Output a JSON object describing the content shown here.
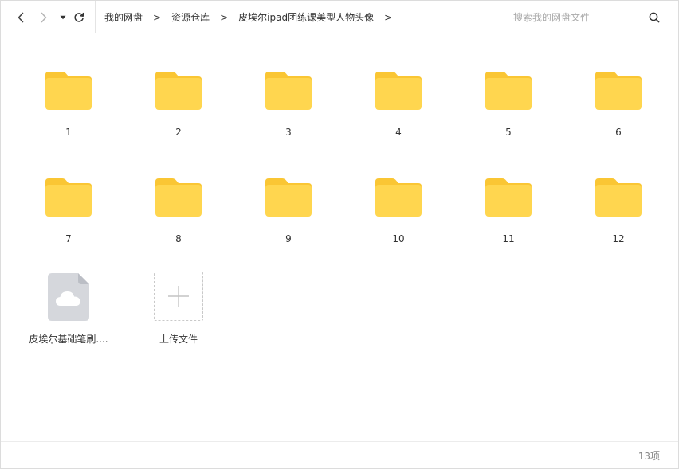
{
  "toolbar": {
    "breadcrumbs": [
      "我的网盘",
      "资源仓库",
      "皮埃尔ipad团练课美型人物头像"
    ],
    "separator": ">",
    "search": {
      "placeholder": "搜索我的网盘文件",
      "value": ""
    }
  },
  "items": [
    {
      "name": "1",
      "type": "folder"
    },
    {
      "name": "2",
      "type": "folder"
    },
    {
      "name": "3",
      "type": "folder"
    },
    {
      "name": "4",
      "type": "folder"
    },
    {
      "name": "5",
      "type": "folder"
    },
    {
      "name": "6",
      "type": "folder"
    },
    {
      "name": "7",
      "type": "folder"
    },
    {
      "name": "8",
      "type": "folder"
    },
    {
      "name": "9",
      "type": "folder"
    },
    {
      "name": "10",
      "type": "folder"
    },
    {
      "name": "11",
      "type": "folder"
    },
    {
      "name": "12",
      "type": "folder"
    },
    {
      "name": "皮埃尔基础笔刷....",
      "type": "cloud-file"
    }
  ],
  "upload": {
    "label": "上传文件"
  },
  "status": {
    "count": "13项"
  },
  "colors": {
    "folder_front": "#FFD64F",
    "folder_back": "#FAC634",
    "file_body": "#D5D7DC",
    "file_fold": "#BBBEC5"
  }
}
